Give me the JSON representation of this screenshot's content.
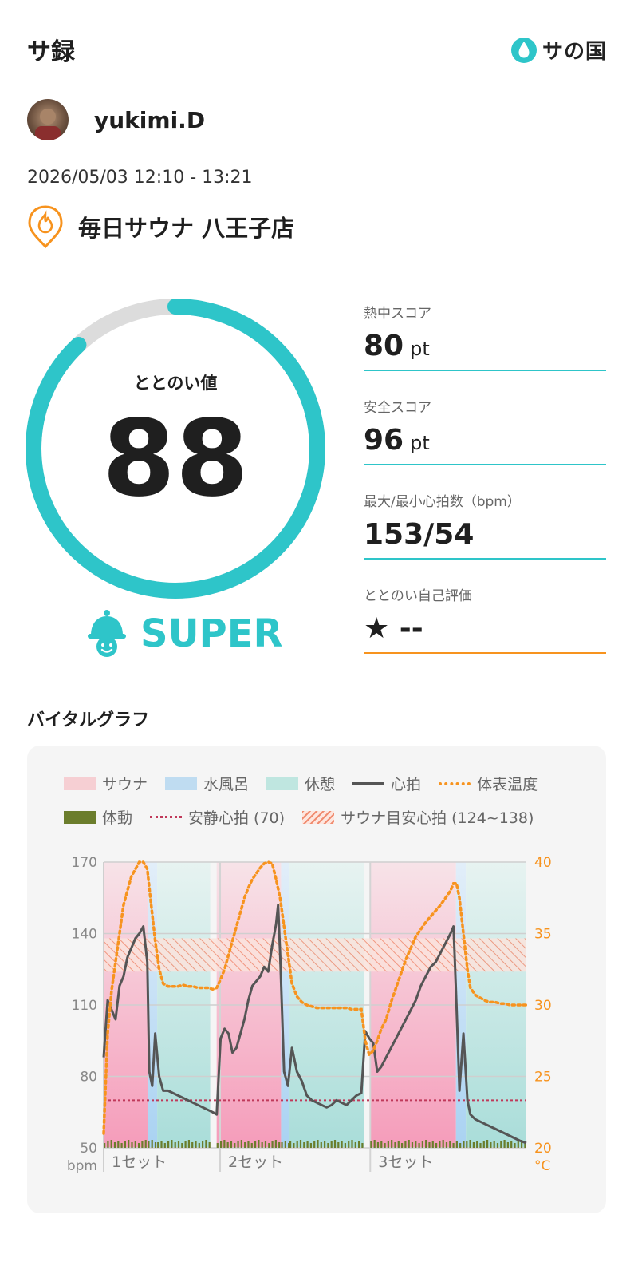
{
  "header": {
    "title": "サ録",
    "brand": "サの国"
  },
  "user": {
    "name": "yukimi.D"
  },
  "session": {
    "datetime": "2026/05/03 12:10 - 13:21",
    "facility": "毎日サウナ 八王子店"
  },
  "gauge": {
    "label": "ととのい値",
    "value": "88",
    "max": 100,
    "rank": "SUPER"
  },
  "stats": {
    "heat": {
      "label": "熱中スコア",
      "value": "80",
      "unit": "pt"
    },
    "safety": {
      "label": "安全スコア",
      "value": "96",
      "unit": "pt"
    },
    "heart": {
      "label": "最大/最小心拍数（bpm）",
      "value": "153/54"
    },
    "self_eval": {
      "label": "ととのい自己評価",
      "value": "★ --"
    }
  },
  "vital": {
    "title": "バイタルグラフ",
    "legend": {
      "sauna": "サウナ",
      "water": "水風呂",
      "rest": "休憩",
      "hr": "心拍",
      "temp": "体表温度",
      "motion": "体動",
      "resting": "安静心拍 (70)",
      "target": "サウナ目安心拍 (124~138)"
    },
    "left_unit": "bpm",
    "right_unit": "°C",
    "set_labels": [
      "1セット",
      "2セット",
      "3セット"
    ]
  },
  "colors": {
    "accent": "#2ec5c9",
    "orange": "#f7931e",
    "hr_line": "#555555",
    "resting_line": "#c0395a",
    "motion": "#6b7d2c"
  },
  "chart_data": {
    "type": "line",
    "x_unit": "minutes",
    "left_axis": {
      "label": "bpm",
      "ticks": [
        50,
        80,
        110,
        140,
        170
      ],
      "ylim": [
        50,
        170
      ]
    },
    "right_axis": {
      "label": "°C",
      "ticks": [
        20,
        25,
        30,
        35,
        40
      ],
      "ylim": [
        20,
        40
      ]
    },
    "resting_hr": 70,
    "target_hr": [
      124,
      138
    ],
    "phases": [
      {
        "type": "sauna",
        "start": 0,
        "end": 8.9
      },
      {
        "type": "water",
        "start": 8.9,
        "end": 10.8
      },
      {
        "type": "rest",
        "start": 10.8,
        "end": 21.5
      },
      {
        "type": "sauna",
        "start": 22.8,
        "end": 35.8
      },
      {
        "type": "water",
        "start": 35.8,
        "end": 37.5
      },
      {
        "type": "rest",
        "start": 37.5,
        "end": 52.5
      },
      {
        "type": "sauna",
        "start": 53.8,
        "end": 71.1
      },
      {
        "type": "water",
        "start": 71.1,
        "end": 73.1
      },
      {
        "type": "rest",
        "start": 73.1,
        "end": 85.3
      }
    ],
    "set_starts": [
      0,
      23.5,
      53.8
    ],
    "series": [
      {
        "name": "心拍",
        "axis": "left",
        "x": [
          0,
          0.8,
          1.6,
          2.4,
          3.2,
          4,
          4.8,
          5.6,
          6.4,
          7.2,
          8,
          8.8,
          9.2,
          9.8,
          10.4,
          11.2,
          12,
          13,
          14,
          15,
          16,
          17,
          18,
          19,
          20,
          21,
          22,
          22.8,
          23.6,
          24.4,
          25.2,
          26,
          26.8,
          27.6,
          28.4,
          29.2,
          30,
          30.8,
          31.6,
          32.4,
          33.2,
          34,
          34.8,
          35.2,
          35.6,
          36.4,
          37.2,
          38,
          39,
          40,
          41,
          42,
          43,
          44,
          45,
          46,
          47,
          48,
          49,
          50,
          51,
          52,
          52.8,
          53.6,
          54.4,
          55.2,
          56,
          57,
          58,
          59,
          60,
          61,
          62,
          63,
          64,
          65,
          66,
          67,
          68,
          69,
          70,
          70.6,
          71.2,
          71.8,
          72.6,
          73.4,
          74,
          75,
          76,
          77,
          78,
          79,
          80,
          81,
          82,
          83,
          84,
          85.3
        ],
        "values": [
          88,
          112,
          108,
          104,
          118,
          122,
          130,
          134,
          138,
          140,
          143,
          128,
          82,
          76,
          98,
          80,
          74,
          74,
          73,
          72,
          71,
          70,
          69,
          68,
          67,
          66,
          65,
          64,
          96,
          100,
          98,
          90,
          92,
          98,
          104,
          112,
          118,
          120,
          122,
          126,
          124,
          135,
          144,
          152,
          132,
          82,
          76,
          92,
          82,
          78,
          72,
          70,
          69,
          68,
          67,
          68,
          70,
          69,
          68,
          70,
          72,
          73,
          99,
          96,
          94,
          82,
          84,
          88,
          92,
          96,
          100,
          104,
          108,
          112,
          118,
          122,
          126,
          128,
          132,
          136,
          140,
          143,
          110,
          74,
          98,
          70,
          64,
          62,
          61,
          60,
          59,
          58,
          57,
          56,
          55,
          54,
          53,
          52
        ]
      },
      {
        "name": "体表温度",
        "axis": "right",
        "x": [
          0,
          0.8,
          1.6,
          2.4,
          3.2,
          4,
          4.8,
          5.6,
          6.4,
          7.2,
          8,
          8.8,
          9.6,
          10.4,
          11.2,
          12,
          13,
          14,
          15,
          16,
          17,
          18,
          19,
          20,
          21,
          22,
          22.8,
          23.6,
          24.4,
          25.2,
          26,
          26.8,
          27.6,
          28.4,
          29.2,
          30,
          30.8,
          31.6,
          32.4,
          33.2,
          34,
          34.8,
          35.6,
          36.4,
          37.2,
          38,
          39,
          40,
          41,
          42,
          43,
          44,
          45,
          46,
          47,
          48,
          49,
          50,
          51,
          52,
          52.8,
          53.6,
          54.4,
          55.2,
          56,
          57,
          58,
          59,
          60,
          61,
          62,
          63,
          64,
          65,
          66,
          67,
          68,
          69,
          70,
          70.6,
          71.2,
          71.8,
          72.6,
          73.4,
          74,
          75,
          76,
          77,
          78,
          79,
          80,
          81,
          82,
          83,
          84,
          85.3
        ],
        "values": [
          21,
          28,
          31,
          33,
          35,
          37,
          38,
          39,
          39.5,
          40,
          40,
          39.5,
          37,
          34.5,
          32.5,
          31.5,
          31.3,
          31.3,
          31.3,
          31.4,
          31.3,
          31.3,
          31.2,
          31.2,
          31.2,
          31.1,
          31.2,
          31.8,
          32.5,
          33.5,
          34.5,
          35.5,
          36.5,
          37.5,
          38.2,
          38.8,
          39.2,
          39.6,
          39.9,
          40,
          39.9,
          38.8,
          37.5,
          35.5,
          33.5,
          31.5,
          30.6,
          30.2,
          30,
          29.9,
          29.8,
          29.8,
          29.8,
          29.8,
          29.8,
          29.8,
          29.8,
          29.7,
          29.7,
          29.7,
          27.5,
          26.5,
          26.8,
          27.5,
          28.3,
          29,
          30.2,
          31.2,
          32.2,
          33.2,
          34,
          34.8,
          35.3,
          35.8,
          36.2,
          36.6,
          37,
          37.5,
          38,
          38.5,
          38.5,
          37.5,
          35,
          32.5,
          31.2,
          30.7,
          30.5,
          30.3,
          30.2,
          30.2,
          30.1,
          30.1,
          30,
          30,
          30,
          30
        ]
      }
    ]
  }
}
